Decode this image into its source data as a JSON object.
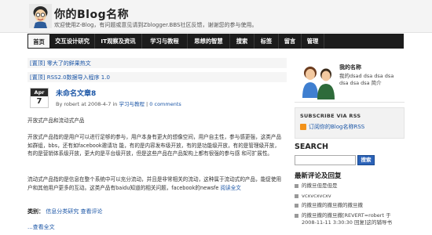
{
  "header": {
    "title": "你的Blog名称",
    "description": "欢迎使用Z-Blog，有问题或意见请到Zblogger.BBS社区反馈，谢谢您的参与使用。"
  },
  "nav": {
    "items": [
      {
        "label": "首页",
        "active": true
      },
      {
        "label": "交互设计研究",
        "active": false
      },
      {
        "label": "IT观察及资讯",
        "active": false
      },
      {
        "label": "学习与教程",
        "active": false
      },
      {
        "label": "思想的智慧",
        "active": false
      },
      {
        "label": "搜索",
        "active": false
      },
      {
        "label": "标签",
        "active": false
      },
      {
        "label": "留言",
        "active": false
      },
      {
        "label": "管理",
        "active": false
      }
    ]
  },
  "main": {
    "recommended": [
      {
        "tag": "[置顶]",
        "text": "零大了的鲜果热文"
      },
      {
        "tag": "[置顶]",
        "text": "RSS2.0数据导入程序 1.0"
      }
    ],
    "post": {
      "month": "Apr",
      "day": "7",
      "title": "未命名文章8",
      "meta_prefix": "By robert at 2008-4-7 in",
      "category": "学习与教程",
      "comments": "0 comments",
      "paragraphs": [
        "开放式产品和流动式产品",
        "开放式产品指的是用户可以进行足够的参与，用户本身有更大的想像空间，用户自主性，参与感更强，这类产品如群组，bbs，还有如facebook邀请功 能，有的是内容发布级开放，有的是功能级开放，有的是管理级开放，有的是营销体系级开放，更大的是平台级开放，但是这些产品在产品架构上都有很强的参与感 和可扩展性。",
        "流动式产品指的是信息在整个系统中可以充分流动，并且是非常相关的流动，这种属于流动式的产品，能促使用户和其他用户更多的互动。这类产品有baidu知道的相关问题，facebook的newsfe"
      ],
      "view_all": "阅读全文",
      "category_label": "类别：",
      "category_link": "信息分类研究",
      "comments_link": "查看评论",
      "more": "...查看全文"
    }
  },
  "sidebar": {
    "author": {
      "title": "我的名称",
      "description": "我的dsad dsa dsa dsa dsa dsa dsa 简介"
    },
    "subscribe": {
      "title": "SUBSCRIBE VIA RSS",
      "link": "订阅你的Blog名称RSS"
    },
    "search": {
      "title": "SEARCH",
      "input_value": "",
      "button": "搜索"
    },
    "comments": {
      "title": "最新评论及回复",
      "items": [
        "的撒旦但是但是",
        "vcxvcxvcxv",
        "的撒旦撒的撒旦撒的撒旦撒",
        "的撒旦撒的撒旦撒[REVERT=robert 于2008-11-11 3:30:30 回复]这的辅导书"
      ]
    }
  },
  "colors": {
    "nav_background": "#1c1c1c",
    "link": "#1a55a6",
    "header_background": "#f4f4f4",
    "rss_orange": "#f39219",
    "search_button": "#2b62b8"
  }
}
